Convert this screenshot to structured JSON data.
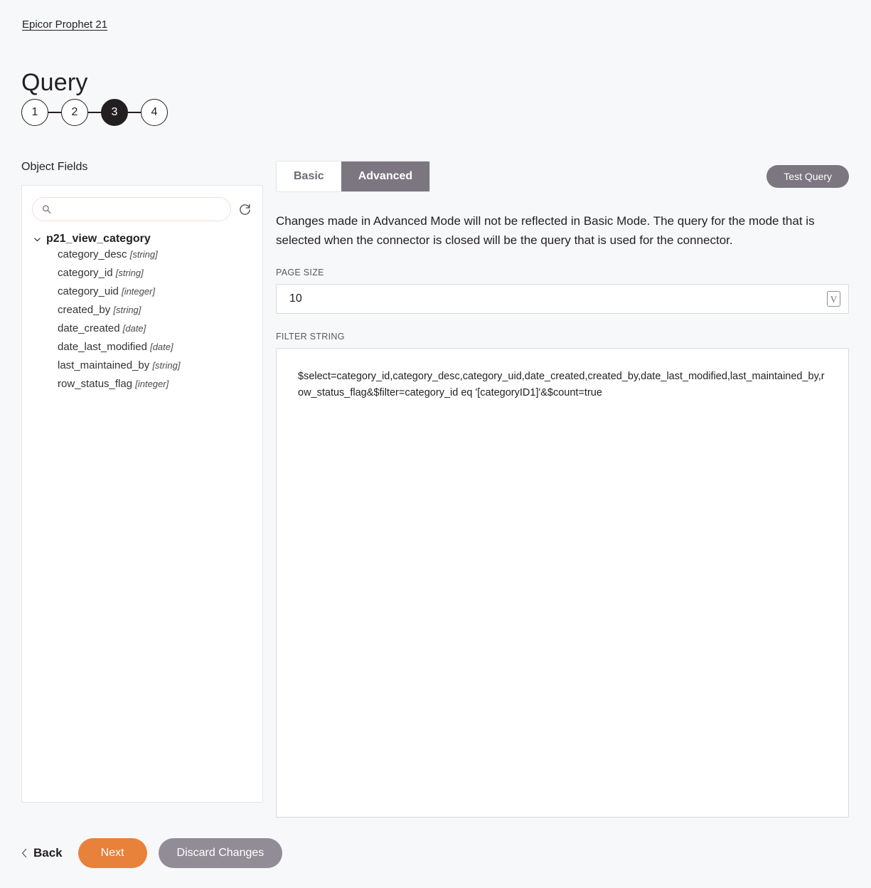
{
  "breadcrumb": {
    "label": "Epicor Prophet 21"
  },
  "page_title": "Query",
  "stepper": {
    "steps": [
      {
        "label": "1",
        "active": false
      },
      {
        "label": "2",
        "active": false
      },
      {
        "label": "3",
        "active": true
      },
      {
        "label": "4",
        "active": false
      }
    ]
  },
  "object_fields": {
    "section_label": "Object Fields",
    "search": {
      "value": "",
      "placeholder": "",
      "icon": "search-icon"
    },
    "refresh_icon": "refresh-icon",
    "tree": {
      "root": {
        "label": "p21_view_category",
        "expanded": true,
        "icon": "chevron-down-icon"
      },
      "children": [
        {
          "name": "category_desc",
          "type": "[string]"
        },
        {
          "name": "category_id",
          "type": "[string]"
        },
        {
          "name": "category_uid",
          "type": "[integer]"
        },
        {
          "name": "created_by",
          "type": "[string]"
        },
        {
          "name": "date_created",
          "type": "[date]"
        },
        {
          "name": "date_last_modified",
          "type": "[date]"
        },
        {
          "name": "last_maintained_by",
          "type": "[string]"
        },
        {
          "name": "row_status_flag",
          "type": "[integer]"
        }
      ]
    }
  },
  "query_panel": {
    "tabs": [
      {
        "label": "Basic",
        "active": false
      },
      {
        "label": "Advanced",
        "active": true
      }
    ],
    "test_query_label": "Test Query",
    "notice": "Changes made in Advanced Mode will not be reflected in Basic Mode. The query for the mode that is selected when the connector is closed will be the query that is used for the connector.",
    "page_size": {
      "label": "PAGE SIZE",
      "value": "10",
      "placeholder": "",
      "variable_button_label": "V"
    },
    "filter_string": {
      "label": "FILTER STRING",
      "value": "$select=category_id,category_desc,category_uid,date_created,created_by,date_last_modified,last_maintained_by,row_status_flag&$filter=category_id eq '[categoryID1]'&$count=true",
      "placeholder": ""
    }
  },
  "footer": {
    "back_label": "Back",
    "back_icon": "chevron-left-icon",
    "next_label": "Next",
    "discard_label": "Discard Changes"
  },
  "colors": {
    "background": "#f7f8fa",
    "panel": "#ffffff",
    "accent_orange": "#e8813a",
    "gray_button": "#7b7680",
    "discard_gray": "#918c96",
    "step_active": "#231f20",
    "search_border": "#f5ded3"
  }
}
